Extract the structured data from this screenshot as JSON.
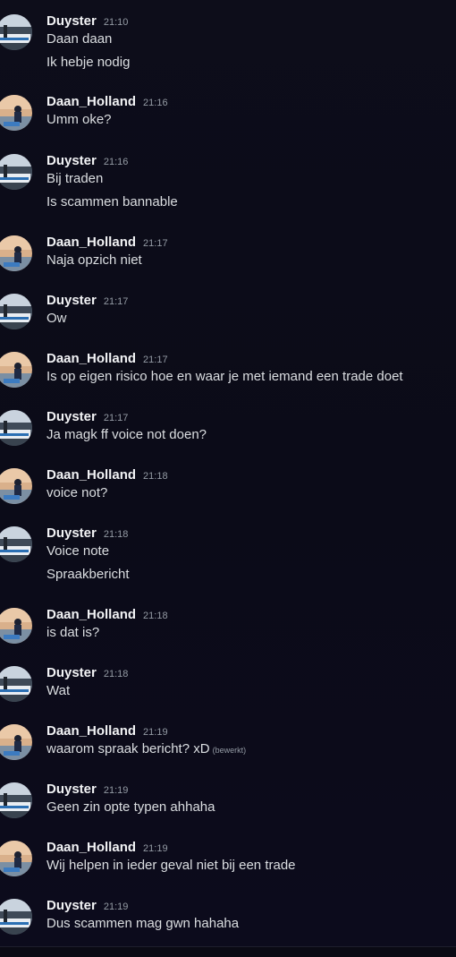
{
  "messages": [
    {
      "author": "Duyster",
      "time": "21:10",
      "lines": [
        "Daan daan",
        "Ik hebje nodig"
      ]
    },
    {
      "author": "Daan_Holland",
      "time": "21:16",
      "lines": [
        "Umm oke?"
      ]
    },
    {
      "author": "Duyster",
      "time": "21:16",
      "lines": [
        "Bij traden",
        "Is scammen bannable"
      ]
    },
    {
      "author": "Daan_Holland",
      "time": "21:17",
      "lines": [
        "Naja opzich niet"
      ]
    },
    {
      "author": "Duyster",
      "time": "21:17",
      "lines": [
        "Ow"
      ]
    },
    {
      "author": "Daan_Holland",
      "time": "21:17",
      "lines": [
        "Is op eigen risico hoe en waar je met iemand een trade doet"
      ]
    },
    {
      "author": "Duyster",
      "time": "21:17",
      "lines": [
        "Ja magk ff voice not doen?"
      ]
    },
    {
      "author": "Daan_Holland",
      "time": "21:18",
      "lines": [
        "voice not?"
      ]
    },
    {
      "author": "Duyster",
      "time": "21:18",
      "lines": [
        "Voice note",
        "Spraakbericht"
      ]
    },
    {
      "author": "Daan_Holland",
      "time": "21:18",
      "lines": [
        "is dat is?"
      ]
    },
    {
      "author": "Duyster",
      "time": "21:18",
      "lines": [
        "Wat"
      ]
    },
    {
      "author": "Daan_Holland",
      "time": "21:19",
      "lines": [
        "waarom spraak bericht? xD"
      ],
      "edited": "(bewerkt)"
    },
    {
      "author": "Duyster",
      "time": "21:19",
      "lines": [
        "Geen zin opte typen ahhaha"
      ]
    },
    {
      "author": "Daan_Holland",
      "time": "21:19",
      "lines": [
        "Wij helpen in ieder geval niet bij een trade"
      ]
    },
    {
      "author": "Duyster",
      "time": "21:19",
      "lines": [
        "Dus scammen mag gwn hahaha"
      ]
    }
  ],
  "colors": {
    "background": "#0c0c19",
    "username": "#f2f3f5",
    "timestamp": "#949ba4",
    "text": "#dbdee1"
  }
}
